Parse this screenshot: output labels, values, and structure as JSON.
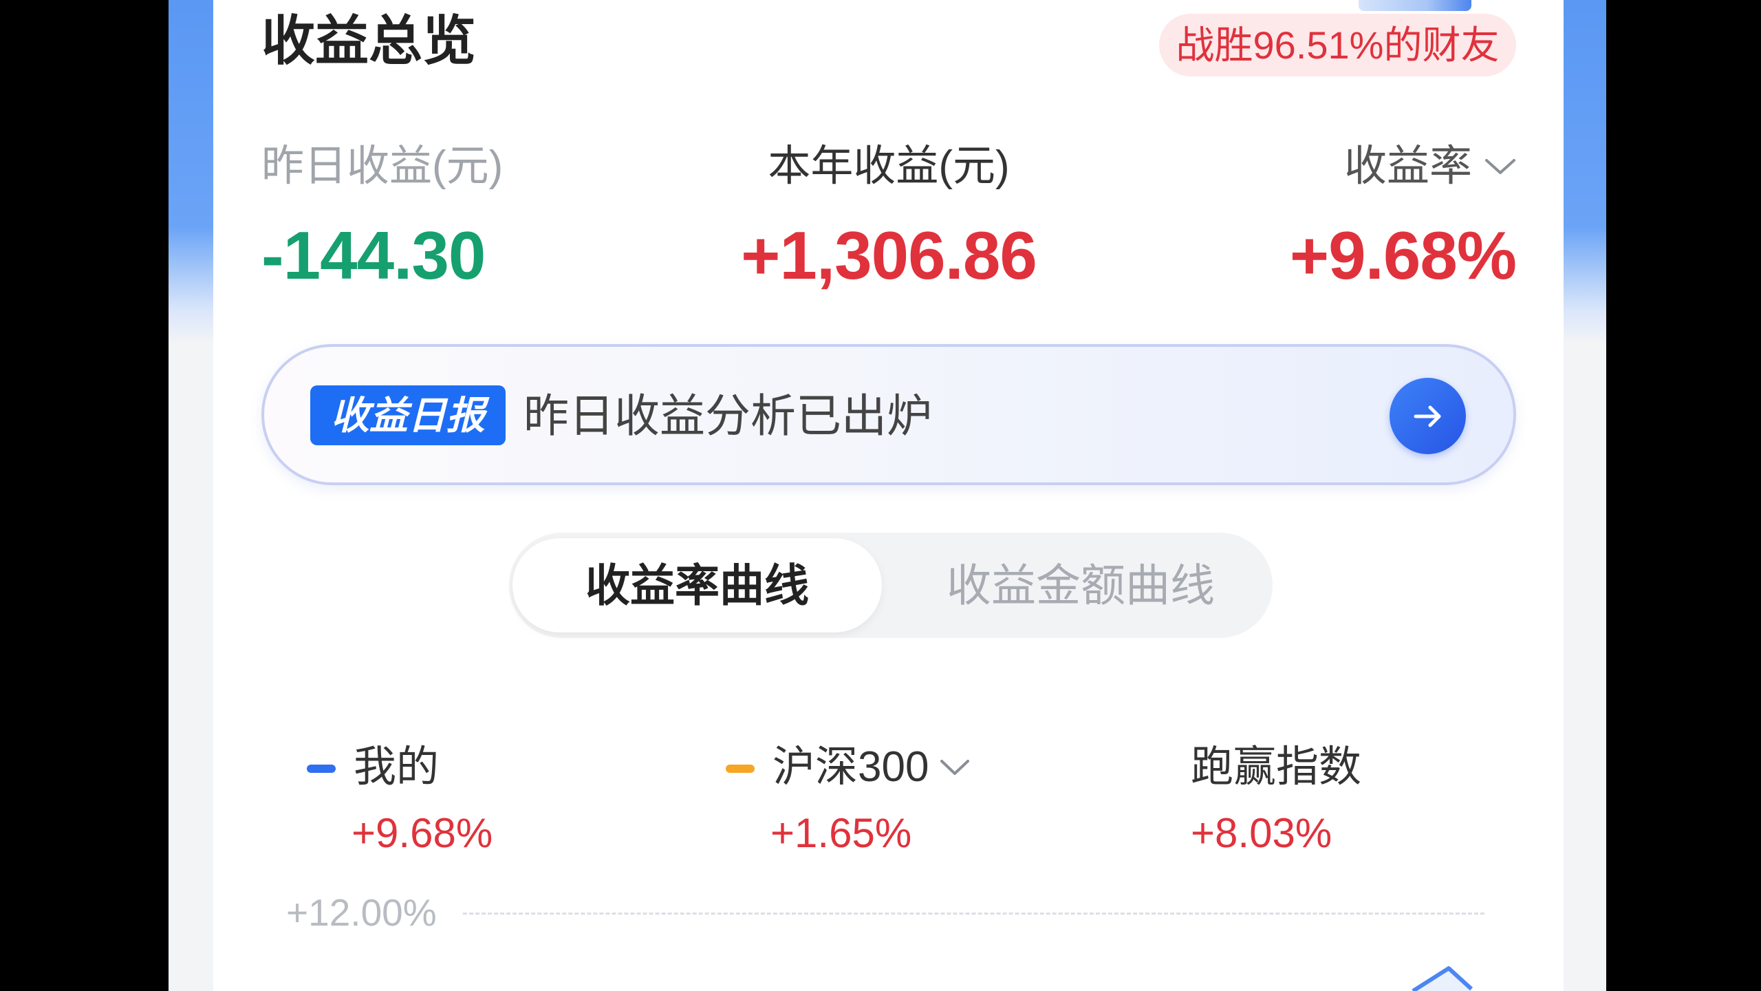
{
  "header": {
    "title": "收益总览",
    "rank_badge": "战胜96.51%的财友"
  },
  "summary": {
    "yesterday": {
      "label": "昨日收益(元)",
      "value": "-144.30"
    },
    "year": {
      "label": "本年收益(元)",
      "value": "+1,306.86"
    },
    "rate": {
      "label": "收益率",
      "value": "+9.68%",
      "icon": "chevron-down-icon"
    }
  },
  "daily_report": {
    "tag": "收益日报",
    "text": "昨日收益分析已出炉",
    "icon": "arrow-right-icon"
  },
  "curve_tabs": [
    {
      "label": "收益率曲线",
      "active": true
    },
    {
      "label": "收益金额曲线",
      "active": false
    }
  ],
  "legend": {
    "mine": {
      "label": "我的",
      "value": "+9.68%",
      "color": "#2f6ff0"
    },
    "benchmark": {
      "label": "沪深300",
      "value": "+1.65%",
      "color": "#f5a623",
      "icon": "chevron-down-icon"
    },
    "outperform": {
      "label": "跑赢指数",
      "value": "+8.03%"
    }
  },
  "chart": {
    "y_ticks": [
      "+12.00%"
    ]
  },
  "colors": {
    "gain": "#e0323c",
    "loss": "#16a06f",
    "accent": "#1e6ef5",
    "badge_bg": "#fde8ea"
  }
}
